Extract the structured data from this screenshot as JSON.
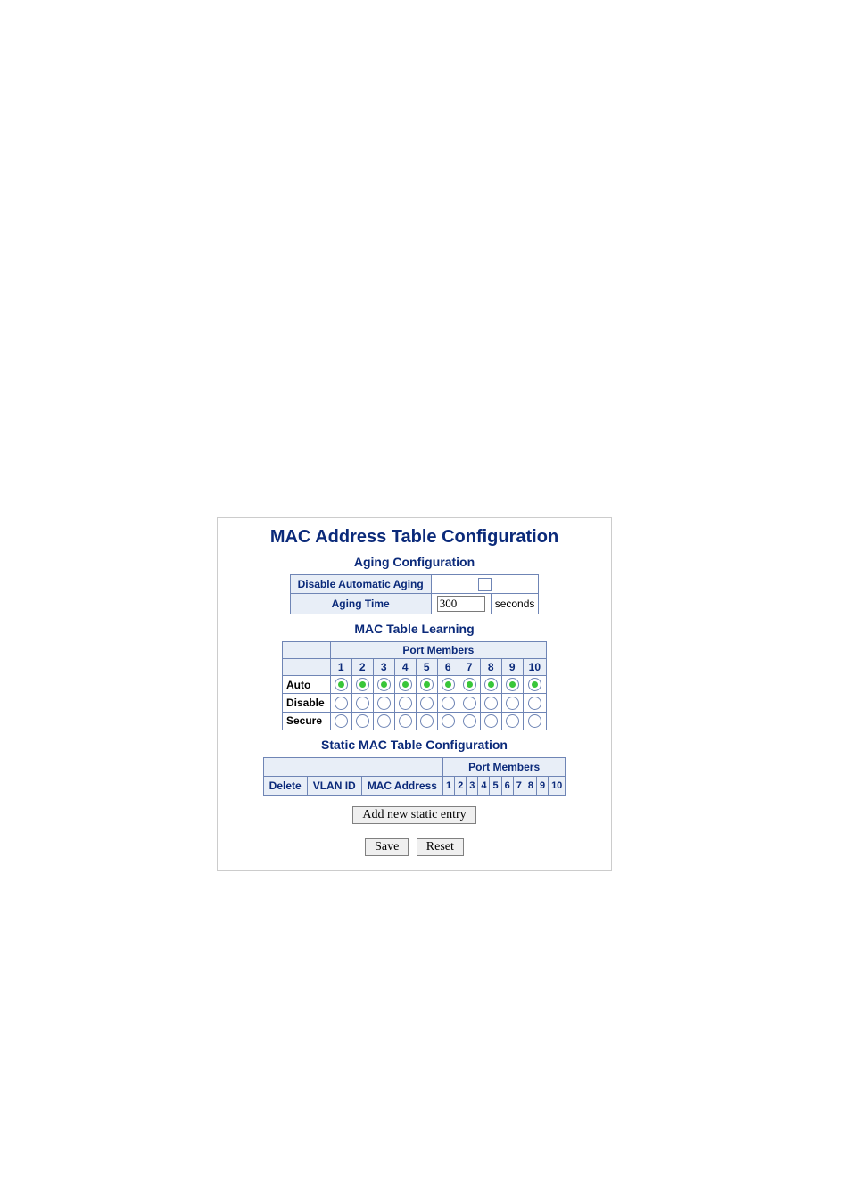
{
  "title": "MAC Address Table Configuration",
  "aging": {
    "section_title": "Aging Configuration",
    "disable_label": "Disable Automatic Aging",
    "disable_checked": false,
    "time_label": "Aging Time",
    "time_value": "300",
    "time_unit": "seconds"
  },
  "learning": {
    "section_title": "MAC Table Learning",
    "port_members_label": "Port Members",
    "ports": [
      "1",
      "2",
      "3",
      "4",
      "5",
      "6",
      "7",
      "8",
      "9",
      "10"
    ],
    "rows": [
      {
        "label": "Auto",
        "selected": [
          true,
          true,
          true,
          true,
          true,
          true,
          true,
          true,
          true,
          true
        ]
      },
      {
        "label": "Disable",
        "selected": [
          false,
          false,
          false,
          false,
          false,
          false,
          false,
          false,
          false,
          false
        ]
      },
      {
        "label": "Secure",
        "selected": [
          false,
          false,
          false,
          false,
          false,
          false,
          false,
          false,
          false,
          false
        ]
      }
    ]
  },
  "static": {
    "section_title": "Static MAC Table Configuration",
    "port_members_label": "Port Members",
    "columns": {
      "delete": "Delete",
      "vlan": "VLAN ID",
      "mac": "MAC Address"
    },
    "ports": [
      "1",
      "2",
      "3",
      "4",
      "5",
      "6",
      "7",
      "8",
      "9",
      "10"
    ]
  },
  "buttons": {
    "add": "Add new static entry",
    "save": "Save",
    "reset": "Reset"
  }
}
